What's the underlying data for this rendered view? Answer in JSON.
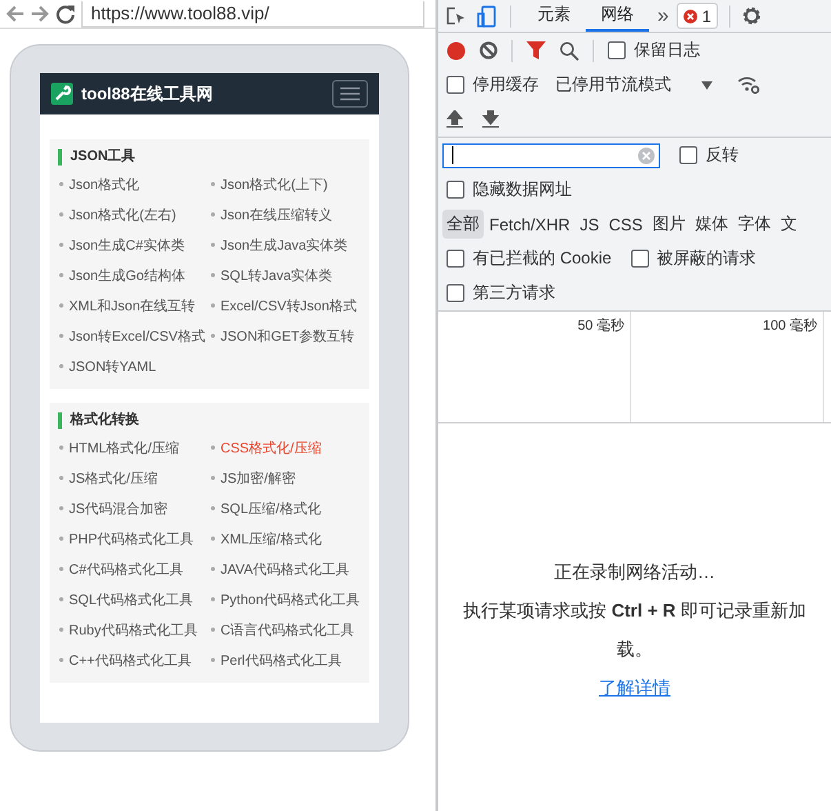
{
  "browser": {
    "url": "https://www.tool88.vip/"
  },
  "site": {
    "title": "tool88在线工具网",
    "sections": [
      {
        "title": "JSON工具",
        "items": [
          {
            "label": "Json格式化",
            "selected": false
          },
          {
            "label": "Json格式化(上下)",
            "selected": false
          },
          {
            "label": "Json格式化(左右)",
            "selected": false
          },
          {
            "label": "Json在线压缩转义",
            "selected": false
          },
          {
            "label": "Json生成C#实体类",
            "selected": false
          },
          {
            "label": "Json生成Java实体类",
            "selected": false
          },
          {
            "label": "Json生成Go结构体",
            "selected": false
          },
          {
            "label": "SQL转Java实体类",
            "selected": false
          },
          {
            "label": "XML和Json在线互转",
            "selected": false
          },
          {
            "label": "Excel/CSV转Json格式",
            "selected": false
          },
          {
            "label": "Json转Excel/CSV格式",
            "selected": false
          },
          {
            "label": "JSON和GET参数互转",
            "selected": false
          },
          {
            "label": "JSON转YAML",
            "selected": false
          }
        ]
      },
      {
        "title": "格式化转换",
        "items": [
          {
            "label": "HTML格式化/压缩",
            "selected": false
          },
          {
            "label": "CSS格式化/压缩",
            "selected": true
          },
          {
            "label": "JS格式化/压缩",
            "selected": false
          },
          {
            "label": "JS加密/解密",
            "selected": false
          },
          {
            "label": "JS代码混合加密",
            "selected": false
          },
          {
            "label": "SQL压缩/格式化",
            "selected": false
          },
          {
            "label": "PHP代码格式化工具",
            "selected": false
          },
          {
            "label": "XML压缩/格式化",
            "selected": false
          },
          {
            "label": "C#代码格式化工具",
            "selected": false
          },
          {
            "label": "JAVA代码格式化工具",
            "selected": false
          },
          {
            "label": "SQL代码格式化工具",
            "selected": false
          },
          {
            "label": "Python代码格式化工具",
            "selected": false
          },
          {
            "label": "Ruby代码格式化工具",
            "selected": false
          },
          {
            "label": "C语言代码格式化工具",
            "selected": false
          },
          {
            "label": "C++代码格式化工具",
            "selected": false
          },
          {
            "label": "Perl代码格式化工具",
            "selected": false
          }
        ]
      }
    ]
  },
  "devtools": {
    "tabs": [
      {
        "label": "元素",
        "selected": false
      },
      {
        "label": "网络",
        "selected": true
      }
    ],
    "more": "»",
    "error_count": "1",
    "preserve_log": {
      "label": "保留日志",
      "checked": false
    },
    "disable_cache": {
      "label": "停用缓存",
      "checked": false
    },
    "throttling": "已停用节流模式",
    "filter": {
      "focused": true
    },
    "invert": {
      "label": "反转",
      "checked": false
    },
    "hide_data_urls": {
      "label": "隐藏数据网址",
      "checked": false
    },
    "type_filters": [
      {
        "label": "全部",
        "selected": true
      },
      {
        "label": "Fetch/XHR",
        "selected": false
      },
      {
        "label": "JS",
        "selected": false
      },
      {
        "label": "CSS",
        "selected": false
      },
      {
        "label": "图片",
        "selected": false
      },
      {
        "label": "媒体",
        "selected": false
      },
      {
        "label": "字体",
        "selected": false
      },
      {
        "label": "文",
        "selected": false
      }
    ],
    "blocked_options": [
      {
        "label": "有已拦截的 Cookie",
        "checked": false
      },
      {
        "label": "被屏蔽的请求",
        "checked": false
      }
    ],
    "third_party": {
      "label": "第三方请求",
      "checked": false
    },
    "timeline_ticks": [
      "50 毫秒",
      "100 毫秒"
    ],
    "message": {
      "title": "正在录制网络活动…",
      "body": "执行某项请求或按 **Ctrl + R** 即可记录重新加载。",
      "link": "了解详情"
    }
  }
}
